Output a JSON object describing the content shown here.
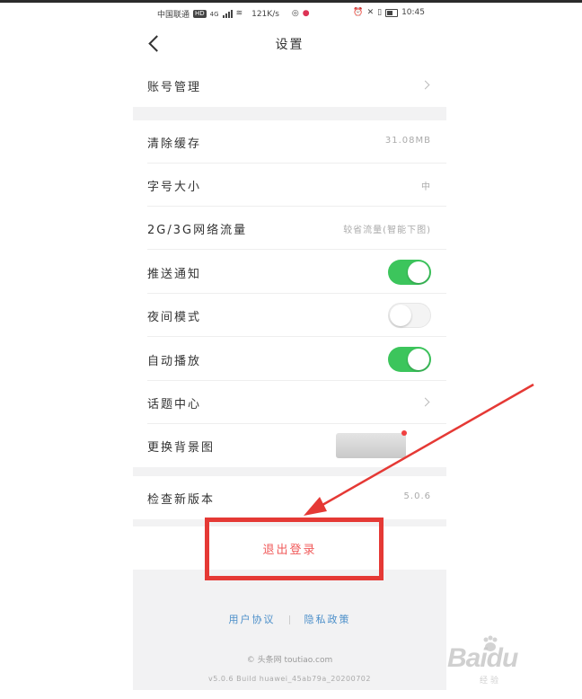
{
  "status_bar": {
    "carrier": "中国联通",
    "hd_badge": "HD",
    "network": "4G",
    "speed": "121K/s",
    "time": "10:45"
  },
  "nav": {
    "title": "设置"
  },
  "account": {
    "label": "账号管理"
  },
  "settings": {
    "clear_cache": {
      "label": "清除缓存",
      "value": "31.08MB"
    },
    "font_size": {
      "label": "字号大小",
      "value": "中"
    },
    "network_traffic": {
      "label": "2G/3G网络流量",
      "value": "较省流量(智能下图)"
    },
    "push": {
      "label": "推送通知",
      "state": "on"
    },
    "night_mode": {
      "label": "夜间模式",
      "state": "off"
    },
    "autoplay": {
      "label": "自动播放",
      "state": "on"
    },
    "topic_center": {
      "label": "话题中心"
    },
    "change_background": {
      "label": "更换背景图"
    }
  },
  "version": {
    "label": "检查新版本",
    "value": "5.0.6"
  },
  "logout": {
    "label": "退出登录"
  },
  "footer": {
    "user_agreement": "用户协议",
    "privacy_policy": "隐私政策",
    "brand": "© 头条网 toutiao.com",
    "build": "v5.0.6 Build huawei_45ab79a_20200702"
  },
  "colors": {
    "toggle_on": "#3cc55c",
    "annotation_red": "#e53935",
    "logout_red": "#f05a5a",
    "link_blue": "#4a8ec9"
  },
  "watermark": {
    "text": "Baidu",
    "sub": "经验"
  }
}
